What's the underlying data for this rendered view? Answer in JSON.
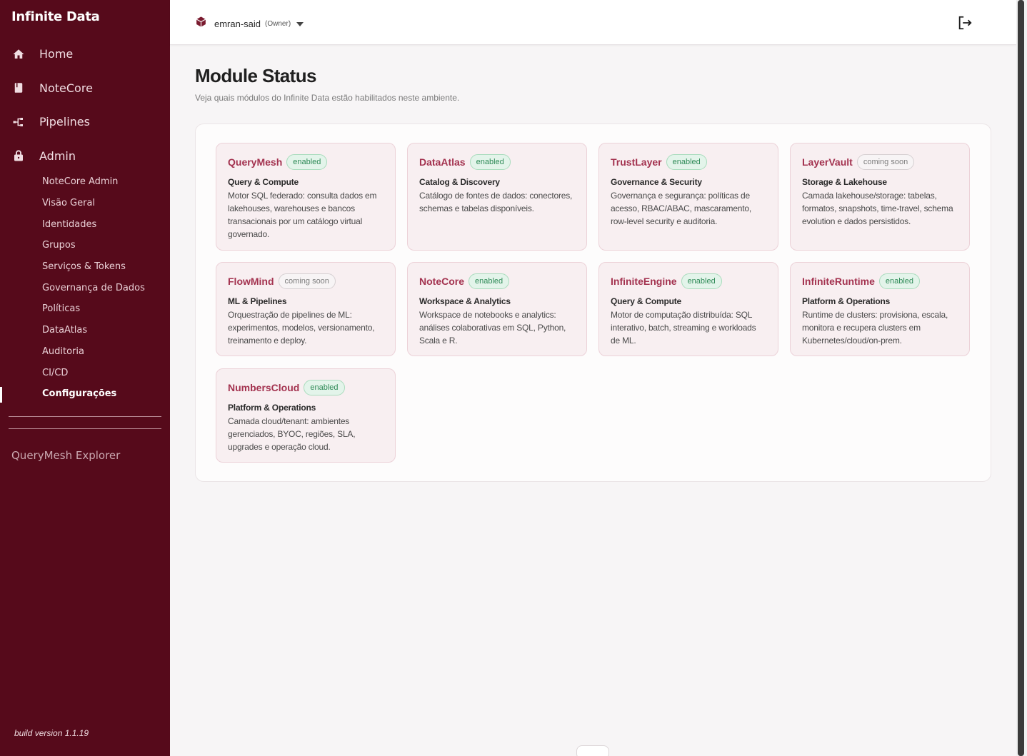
{
  "brand": "Infinite Data",
  "nav": [
    {
      "label": "Home",
      "icon": "home-icon"
    },
    {
      "label": "NoteCore",
      "icon": "notebook-icon"
    },
    {
      "label": "Pipelines",
      "icon": "pipeline-icon"
    },
    {
      "label": "Admin",
      "icon": "lock-icon"
    }
  ],
  "admin_subnav": [
    "NoteCore Admin",
    "Visão Geral",
    "Identidades",
    "Grupos",
    "Serviços & Tokens",
    "Governança de Dados",
    "Políticas",
    "DataAtlas",
    "Auditoria",
    "CI/CD",
    "Configurações"
  ],
  "active_subnav": "Configurações",
  "explorer_label": "QueryMesh Explorer",
  "build_version": "build version 1.1.19",
  "header": {
    "user": "emran-said",
    "role": "(Owner)"
  },
  "page": {
    "title": "Module Status",
    "subtitle": "Veja quais módulos do Infinite Data estão habilitados neste ambiente."
  },
  "modules": [
    {
      "name": "QueryMesh",
      "status": "enabled",
      "category": "Query & Compute",
      "description": "Motor SQL federado: consulta dados em lakehouses, warehouses e bancos transacionais por um catálogo virtual governado."
    },
    {
      "name": "DataAtlas",
      "status": "enabled",
      "category": "Catalog & Discovery",
      "description": "Catálogo de fontes de dados: conectores, schemas e tabelas disponíveis."
    },
    {
      "name": "TrustLayer",
      "status": "enabled",
      "category": "Governance & Security",
      "description": "Governança e segurança: políticas de acesso, RBAC/ABAC, mascaramento, row-level security e auditoria."
    },
    {
      "name": "LayerVault",
      "status": "coming soon",
      "category": "Storage & Lakehouse",
      "description": "Camada lakehouse/storage: tabelas, formatos, snapshots, time-travel, schema evolution e dados persistidos."
    },
    {
      "name": "FlowMind",
      "status": "coming soon",
      "category": "ML & Pipelines",
      "description": "Orquestração de pipelines de ML: experimentos, modelos, versionamento, treinamento e deploy."
    },
    {
      "name": "NoteCore",
      "status": "enabled",
      "category": "Workspace & Analytics",
      "description": "Workspace de notebooks e analytics: análises colaborativas em SQL, Python, Scala e R."
    },
    {
      "name": "InfiniteEngine",
      "status": "enabled",
      "category": "Query & Compute",
      "description": "Motor de computação distribuída: SQL interativo, batch, streaming e workloads de ML."
    },
    {
      "name": "InfiniteRuntime",
      "status": "enabled",
      "category": "Platform & Operations",
      "description": "Runtime de clusters: provisiona, escala, monitora e recupera clusters em Kubernetes/cloud/on-prem."
    },
    {
      "name": "NumbersCloud",
      "status": "enabled",
      "category": "Platform & Operations",
      "description": "Camada cloud/tenant: ambientes gerenciados, BYOC, regiões, SLA, upgrades e operação cloud."
    }
  ],
  "colors": {
    "sidebar": "#560a1b",
    "accent": "#a3324f",
    "enabled_badge": "#2f8a57"
  }
}
